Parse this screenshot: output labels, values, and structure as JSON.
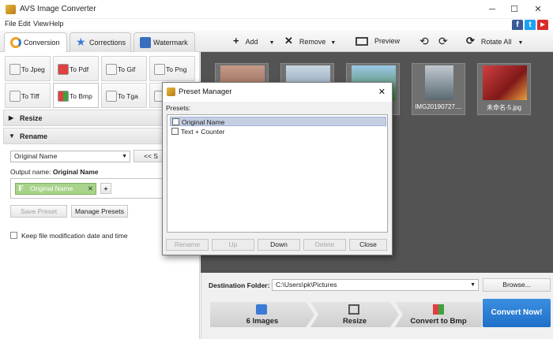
{
  "window": {
    "title": "AVS Image Converter",
    "minimize": "─",
    "maximize": "☐",
    "close": "✕"
  },
  "menu": [
    "File",
    "Edit",
    "View",
    "Help"
  ],
  "social": {
    "facebook": "f",
    "twitter": "t",
    "youtube": "▶"
  },
  "tabs": [
    {
      "label": "Conversion",
      "icon": "sync-icon",
      "color": "#f0a020"
    },
    {
      "label": "Corrections",
      "icon": "star-icon",
      "color": "#3a7bd5"
    },
    {
      "label": "Watermark",
      "icon": "stamp-icon",
      "color": "#3a6fc0"
    }
  ],
  "toolbar": {
    "add": "Add",
    "remove": "Remove",
    "preview": "Preview",
    "rotate_all": "Rotate All"
  },
  "formats": [
    {
      "label": "To Jpeg"
    },
    {
      "label": "To Pdf"
    },
    {
      "label": "To Gif"
    },
    {
      "label": "To Png"
    },
    {
      "label": "To Tiff"
    },
    {
      "label": "To Bmp"
    },
    {
      "label": "To Tga"
    },
    {
      "label": ""
    }
  ],
  "sections": {
    "resize": "Resize",
    "rename": "Rename"
  },
  "rename": {
    "preset_value": "Original Name",
    "set_button": "<< S",
    "output_label": "Output name:",
    "output_value": "Original Name",
    "token_letter": "F",
    "token_label": "Original Name",
    "token_close": "✕",
    "add_token": "+",
    "save_preset": "Save Preset",
    "manage_presets": "Manage Presets",
    "keep_date": "Keep file modification date and time"
  },
  "thumbnails": [
    {
      "caption": "",
      "color": "#b08070"
    },
    {
      "caption": "",
      "color": "#9ab0c4"
    },
    {
      "caption": "",
      "color": "#5a8a50"
    },
    {
      "caption": "IMG20190727....",
      "color": "#7a8890"
    },
    {
      "caption": "未命名-5.jpg",
      "color": "#b03030"
    }
  ],
  "destination": {
    "label": "Destination Folder:",
    "path": "C:\\Users\\pk\\Pictures",
    "browse": "Browse..."
  },
  "steps": [
    {
      "label": "6 Images"
    },
    {
      "label": "Resize"
    },
    {
      "label": "Convert to Bmp"
    }
  ],
  "convert_button": "Convert Now!",
  "dialog": {
    "title": "Preset Manager",
    "close": "✕",
    "presets_label": "Presets:",
    "presets": [
      "Original Name",
      "Text + Counter"
    ],
    "buttons": {
      "rename": "Rename",
      "up": "Up",
      "down": "Down",
      "delete": "Delete",
      "close": "Close"
    }
  }
}
